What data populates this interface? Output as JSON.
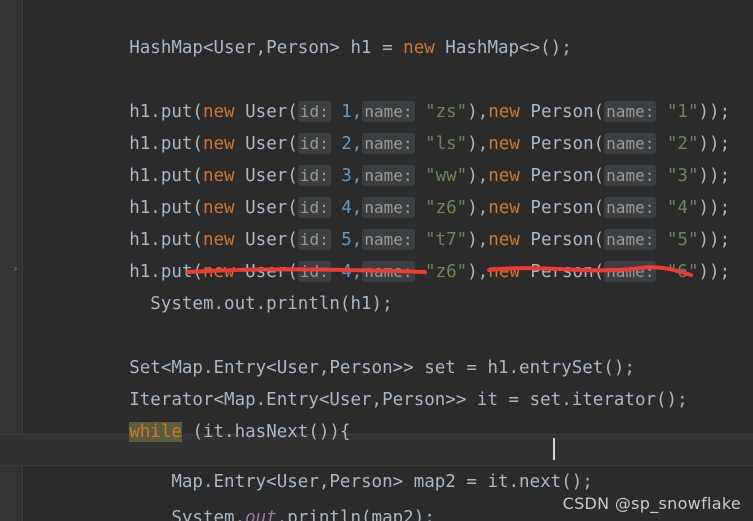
{
  "editor": {
    "theme_bg": "#2b2b2b",
    "gutter_bg": "#313335",
    "text_color": "#a9b7c6",
    "keyword_color": "#cc7832",
    "string_color": "#6a8759",
    "number_color": "#6897bb",
    "hint_bg": "#3b3f41",
    "hint_color": "#9a9a9a",
    "highlight_bg": "#5c5c3d",
    "annotation_color": "#ee3b33",
    "gutter_marker": "›"
  },
  "code": {
    "l1": {
      "p1": "HashMap<User,Person> h1 = ",
      "kw": "new",
      "p2": " HashMap<>();"
    },
    "blank": "",
    "rows": [
      {
        "head": "h1.put(",
        "new1": "new",
        "user": " User(",
        "hint_id": "id:",
        "id": " 1,",
        "hint_name": "name:",
        "str1": " \"zs\"",
        "mid": "),",
        "new2": "new",
        "person": " Person(",
        "hint_pname": "name:",
        "str2": " \"1\"",
        "tail": "));"
      },
      {
        "head": "h1.put(",
        "new1": "new",
        "user": " User(",
        "hint_id": "id:",
        "id": " 2,",
        "hint_name": "name:",
        "str1": " \"ls\"",
        "mid": "),",
        "new2": "new",
        "person": " Person(",
        "hint_pname": "name:",
        "str2": " \"2\"",
        "tail": "));"
      },
      {
        "head": "h1.put(",
        "new1": "new",
        "user": " User(",
        "hint_id": "id:",
        "id": " 3,",
        "hint_name": "name:",
        "str1": " \"ww\"",
        "mid": "),",
        "new2": "new",
        "person": " Person(",
        "hint_pname": "name:",
        "str2": " \"3\"",
        "tail": "));"
      },
      {
        "head": "h1.put(",
        "new1": "new",
        "user": " User(",
        "hint_id": "id:",
        "id": " 4,",
        "hint_name": "name:",
        "str1": " \"z6\"",
        "mid": "),",
        "new2": "new",
        "person": " Person(",
        "hint_pname": "name:",
        "str2": " \"4\"",
        "tail": "));"
      },
      {
        "head": "h1.put(",
        "new1": "new",
        "user": " User(",
        "hint_id": "id:",
        "id": " 5,",
        "hint_name": "name:",
        "str1": " \"t7\"",
        "mid": "),",
        "new2": "new",
        "person": " Person(",
        "hint_pname": "name:",
        "str2": " \"5\"",
        "tail": "));"
      },
      {
        "head": "h1.put(",
        "new1": "new",
        "user": " User(",
        "hint_id": "id:",
        "id": " 4,",
        "hint_name": "name:",
        "str1": " \"z6\"",
        "mid": "),",
        "new2": "new",
        "person": " Person(",
        "hint_pname": "name:",
        "str2": " \"6\"",
        "tail": "));"
      }
    ],
    "println_h1": "  System.out.println(h1);",
    "set_line": {
      "p1": "Set<Map.Entry<User,Person>> set = h1.entrySet();"
    },
    "iterator_line": {
      "p1": "Iterator<Map.Entry<User,Person>> it = set.iterator();"
    },
    "while_line": {
      "kw": "while",
      "rest": " (it.hasNext()){"
    },
    "map2_line": {
      "p1": "    Map.Entry<User,Person> map2 = it.next();"
    },
    "println_map2": {
      "p1": "    System.",
      "ital": "out",
      "p2": ".println(map2);"
    }
  },
  "watermark": "CSDN @sp_snowflake"
}
